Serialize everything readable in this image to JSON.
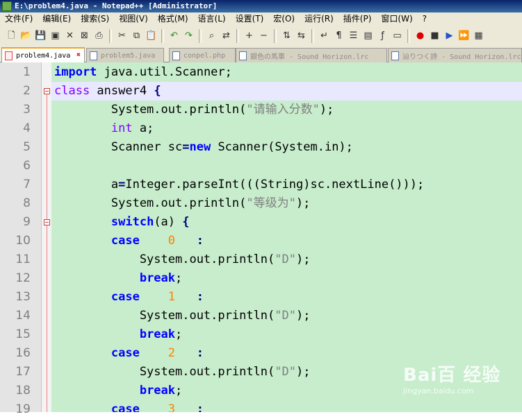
{
  "window": {
    "title": "E:\\problem4.java - Notepad++ [Administrator]"
  },
  "menu": [
    "文件(F)",
    "编辑(E)",
    "搜索(S)",
    "视图(V)",
    "格式(M)",
    "语言(L)",
    "设置(T)",
    "宏(O)",
    "运行(R)",
    "插件(P)",
    "窗口(W)",
    "?"
  ],
  "toolbar": {
    "icons": [
      "new-file-icon",
      "open-file-icon",
      "save-icon",
      "save-all-icon",
      "close-icon",
      "close-all-icon",
      "print-icon",
      "cut-icon",
      "copy-icon",
      "paste-icon",
      "undo-icon",
      "redo-icon",
      "find-icon",
      "replace-icon",
      "zoom-in-icon",
      "zoom-out-icon",
      "sync-vertical-icon",
      "sync-horizontal-icon",
      "wrap-icon",
      "show-all-chars-icon",
      "indent-guide-icon",
      "doc-map-icon",
      "function-list-icon",
      "folder-workspace-icon",
      "record-macro-icon",
      "stop-record-icon",
      "play-macro-icon",
      "run-macro-multiple-icon",
      "save-macro-icon"
    ]
  },
  "tabs": [
    {
      "label": "problem4.java",
      "active": true
    },
    {
      "label": "problem5.java",
      "active": false
    },
    {
      "label": "conpel.php",
      "active": false
    },
    {
      "label": "銀色の馬車 - Sound Horizon.lrc",
      "active": false
    },
    {
      "label": "辿りつく詩 - Sound Horizon.lrc",
      "active": false
    }
  ],
  "editor": {
    "current_line": 2,
    "lines": [
      {
        "n": "1",
        "tokens": [
          [
            "kw",
            "import"
          ],
          [
            "",
            " java.util.Scanner;"
          ]
        ]
      },
      {
        "n": "2",
        "tokens": [
          [
            "kw2",
            "class"
          ],
          [
            "",
            " answer4 "
          ],
          [
            "op",
            "{"
          ]
        ]
      },
      {
        "n": "3",
        "tokens": [
          [
            "",
            "        System.out.println("
          ],
          [
            "str",
            "\"请输入分数\""
          ],
          [
            "",
            ");"
          ]
        ]
      },
      {
        "n": "4",
        "tokens": [
          [
            "",
            "        "
          ],
          [
            "ty",
            "int"
          ],
          [
            "",
            " a;"
          ]
        ]
      },
      {
        "n": "5",
        "tokens": [
          [
            "",
            "        Scanner sc"
          ],
          [
            "op",
            "="
          ],
          [
            "kw",
            "new"
          ],
          [
            "",
            " Scanner(System.in);"
          ]
        ]
      },
      {
        "n": "6",
        "tokens": [
          [
            "",
            ""
          ]
        ]
      },
      {
        "n": "7",
        "tokens": [
          [
            "",
            "        a"
          ],
          [
            "op",
            "="
          ],
          [
            "",
            "Integer.parseInt(((String)sc.nextLine()));"
          ]
        ]
      },
      {
        "n": "8",
        "tokens": [
          [
            "",
            "        System.out.println("
          ],
          [
            "str",
            "\"等级为\""
          ],
          [
            "",
            ");"
          ]
        ]
      },
      {
        "n": "9",
        "tokens": [
          [
            "",
            "        "
          ],
          [
            "kw",
            "switch"
          ],
          [
            "",
            "(a) "
          ],
          [
            "op",
            "{"
          ]
        ]
      },
      {
        "n": "10",
        "tokens": [
          [
            "",
            "        "
          ],
          [
            "kw",
            "case"
          ],
          [
            "",
            "    "
          ],
          [
            "num",
            "0"
          ],
          [
            "",
            "   "
          ],
          [
            "op",
            ":"
          ]
        ]
      },
      {
        "n": "11",
        "tokens": [
          [
            "",
            "            System.out.println("
          ],
          [
            "str",
            "\"D\""
          ],
          [
            "",
            ");"
          ]
        ]
      },
      {
        "n": "12",
        "tokens": [
          [
            "",
            "            "
          ],
          [
            "kw",
            "break"
          ],
          [
            "",
            ";"
          ]
        ]
      },
      {
        "n": "13",
        "tokens": [
          [
            "",
            "        "
          ],
          [
            "kw",
            "case"
          ],
          [
            "",
            "    "
          ],
          [
            "num",
            "1"
          ],
          [
            "",
            "   "
          ],
          [
            "op",
            ":"
          ]
        ]
      },
      {
        "n": "14",
        "tokens": [
          [
            "",
            "            System.out.println("
          ],
          [
            "str",
            "\"D\""
          ],
          [
            "",
            ");"
          ]
        ]
      },
      {
        "n": "15",
        "tokens": [
          [
            "",
            "            "
          ],
          [
            "kw",
            "break"
          ],
          [
            "",
            ";"
          ]
        ]
      },
      {
        "n": "16",
        "tokens": [
          [
            "",
            "        "
          ],
          [
            "kw",
            "case"
          ],
          [
            "",
            "    "
          ],
          [
            "num",
            "2"
          ],
          [
            "",
            "   "
          ],
          [
            "op",
            ":"
          ]
        ]
      },
      {
        "n": "17",
        "tokens": [
          [
            "",
            "            System.out.println("
          ],
          [
            "str",
            "\"D\""
          ],
          [
            "",
            ");"
          ]
        ]
      },
      {
        "n": "18",
        "tokens": [
          [
            "",
            "            "
          ],
          [
            "kw",
            "break"
          ],
          [
            "",
            ";"
          ]
        ]
      },
      {
        "n": "19",
        "tokens": [
          [
            "",
            "        "
          ],
          [
            "kw",
            "case"
          ],
          [
            "",
            "    "
          ],
          [
            "num",
            "3"
          ],
          [
            "",
            "   "
          ],
          [
            "op",
            ":"
          ]
        ]
      }
    ]
  },
  "watermark": {
    "brand": "Bai百 经验",
    "sub": "jingyan.baidu.com"
  }
}
